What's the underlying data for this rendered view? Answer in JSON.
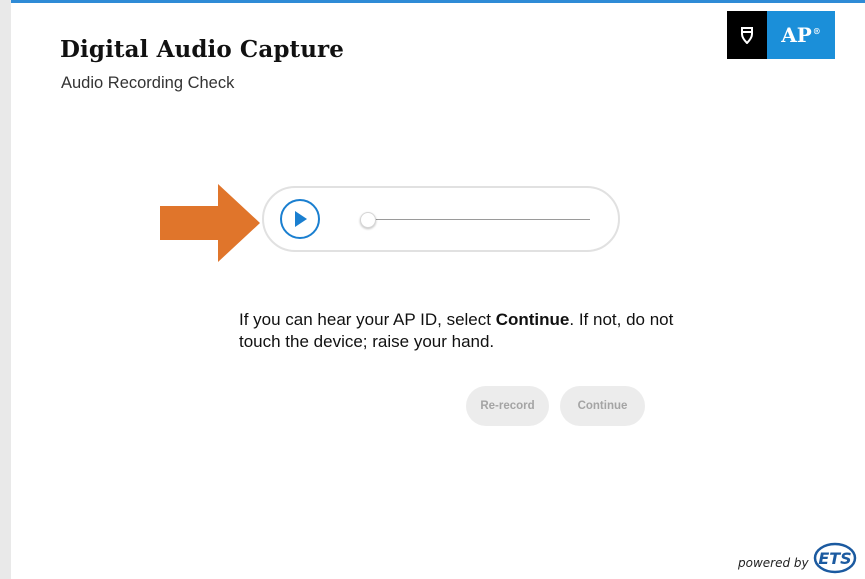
{
  "header": {
    "title": "Digital Audio Capture",
    "subtitle": "Audio Recording Check"
  },
  "logo": {
    "brand_text": "AP",
    "icon": "acorn-shield-icon"
  },
  "player": {
    "play_icon": "play-icon",
    "progress": 0
  },
  "instruction": {
    "part1": "If you can hear your AP ID, select ",
    "bold": "Continue",
    "part2": ". If not, do not touch the device; raise your hand."
  },
  "buttons": {
    "rerecord_label": "Re-record",
    "continue_label": "Continue"
  },
  "footer": {
    "powered_by": "powered by",
    "ets": "ETS"
  },
  "colors": {
    "accent": "#1a7fd0",
    "arrow": "#e0752b",
    "disabled_bg": "#ececec"
  }
}
